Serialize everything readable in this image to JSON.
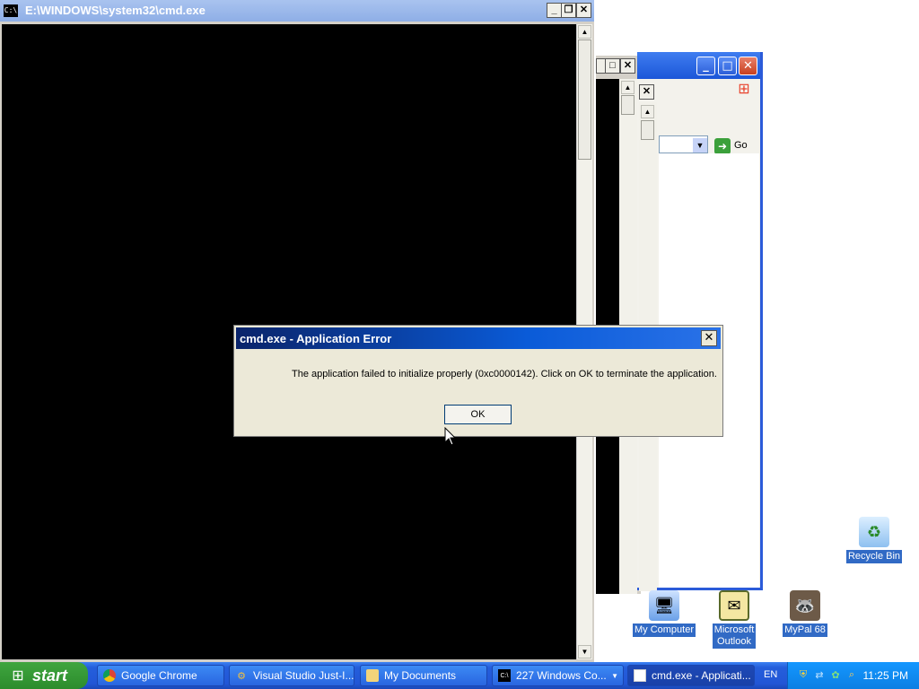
{
  "cmd_window": {
    "title": "E:\\WINDOWS\\system32\\cmd.exe",
    "icon": "cmd-icon",
    "icon_text": "C:\\"
  },
  "background_window": {
    "go_label": "Go"
  },
  "error_dialog": {
    "title": "cmd.exe - Application Error",
    "message": "The application failed to initialize properly (0xc0000142). Click on OK to terminate the application.",
    "ok_label": "OK"
  },
  "desktop_icons": {
    "my_computer": "My Computer",
    "microsoft_outlook_line1": "Microsoft",
    "microsoft_outlook_line2": "Outlook",
    "mypal": "MyPal 68",
    "recycle_bin": "Recycle Bin"
  },
  "taskbar": {
    "start_label": "start",
    "tasks": [
      {
        "label": "Google Chrome",
        "icon": "chrome-icon"
      },
      {
        "label": "Visual Studio Just-I...",
        "icon": "visual-studio-icon"
      },
      {
        "label": "My Documents",
        "icon": "folder-icon"
      },
      {
        "label": "227 Windows Co...",
        "icon": "cmd-icon"
      },
      {
        "label": "cmd.exe - Applicati...",
        "icon": "window-icon"
      }
    ],
    "language": "EN",
    "clock": "11:25 PM"
  },
  "colors": {
    "taskbar_blue": "#245edb",
    "start_green": "#2c8c2c",
    "dialog_title": "#0a5bd8",
    "selection": "#316ac5"
  }
}
